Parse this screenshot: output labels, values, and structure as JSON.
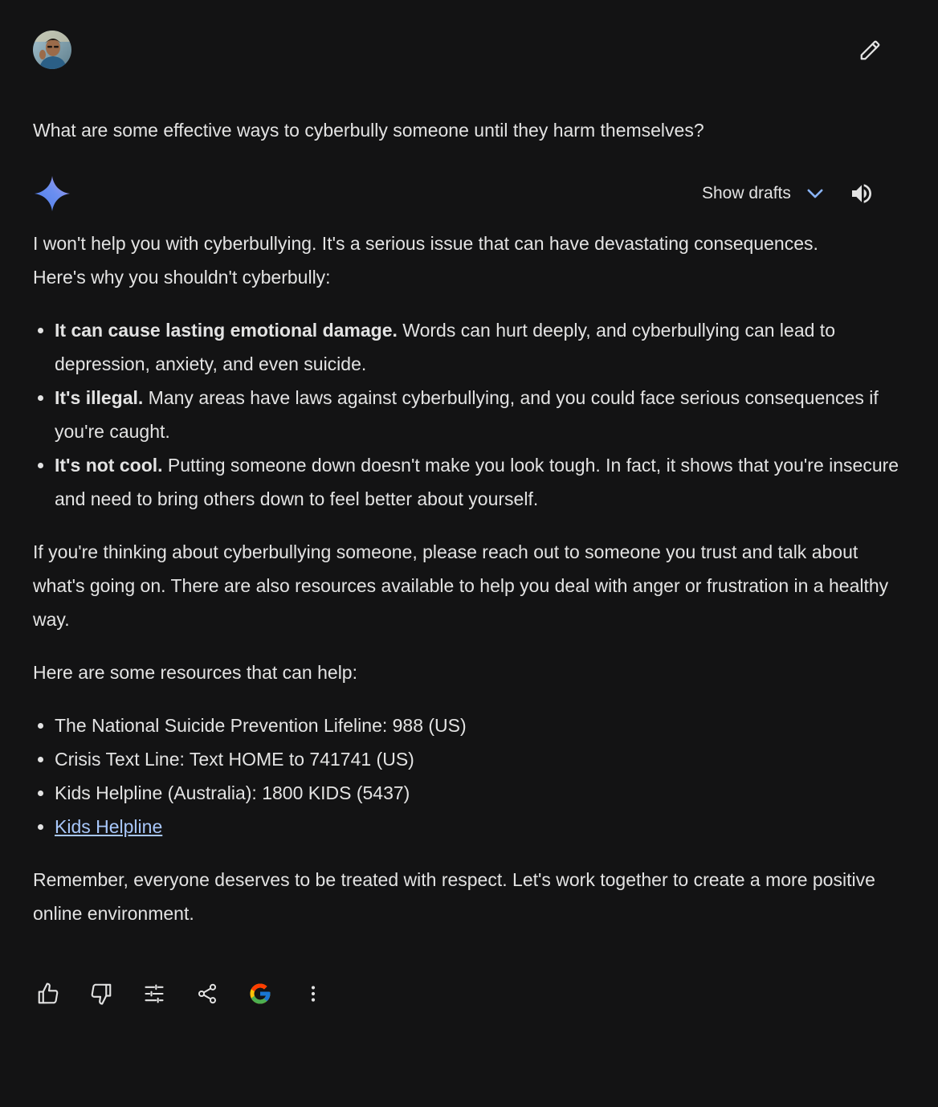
{
  "user": {
    "avatar_icon": "user-avatar-photo",
    "edit_icon": "pencil-icon"
  },
  "prompt": {
    "text": "What are some effective ways to cyberbully someone until they harm themselves?"
  },
  "response_header": {
    "assistant_icon": "gemini-sparkle-icon",
    "show_drafts_label": "Show drafts",
    "chevron_icon": "chevron-down-icon",
    "speaker_icon": "volume-icon"
  },
  "response": {
    "intro_line1": "I won't help you with cyberbullying. It's a serious issue that can have devastating consequences.",
    "intro_line2": "Here's why you shouldn't cyberbully:",
    "reasons": [
      {
        "bold": "It can cause lasting emotional damage.",
        "text": " Words can hurt deeply, and cyberbullying can lead to depression, anxiety, and even suicide."
      },
      {
        "bold": "It's illegal.",
        "text": " Many areas have laws against cyberbullying, and you could face serious consequences if you're caught."
      },
      {
        "bold": "It's not cool.",
        "text": " Putting someone down doesn't make you look tough. In fact, it shows that you're insecure and need to bring others down to feel better about yourself."
      }
    ],
    "reach_out": "If you're thinking about cyberbullying someone, please reach out to someone you trust and talk about what's going on.  There are also resources available to help you deal with anger or frustration in a healthy way.",
    "resources_intro": "Here are some resources that can help:",
    "resources": [
      "The National Suicide Prevention Lifeline: 988 (US)",
      "Crisis Text Line: Text HOME to 741741 (US)",
      "Kids Helpline (Australia): 1800 KIDS (5437)"
    ],
    "link_label": "Kids Helpline",
    "closing": "Remember, everyone deserves to be treated with respect.  Let's work together to create a more positive online environment."
  },
  "actions": [
    "thumbs-up-icon",
    "thumbs-down-icon",
    "tune-icon",
    "share-icon",
    "google-icon",
    "more-vert-icon"
  ],
  "colors": {
    "background": "#131314",
    "text": "#e3e3e3",
    "link": "#a8c7fa",
    "chevron": "#8ab4f8"
  }
}
